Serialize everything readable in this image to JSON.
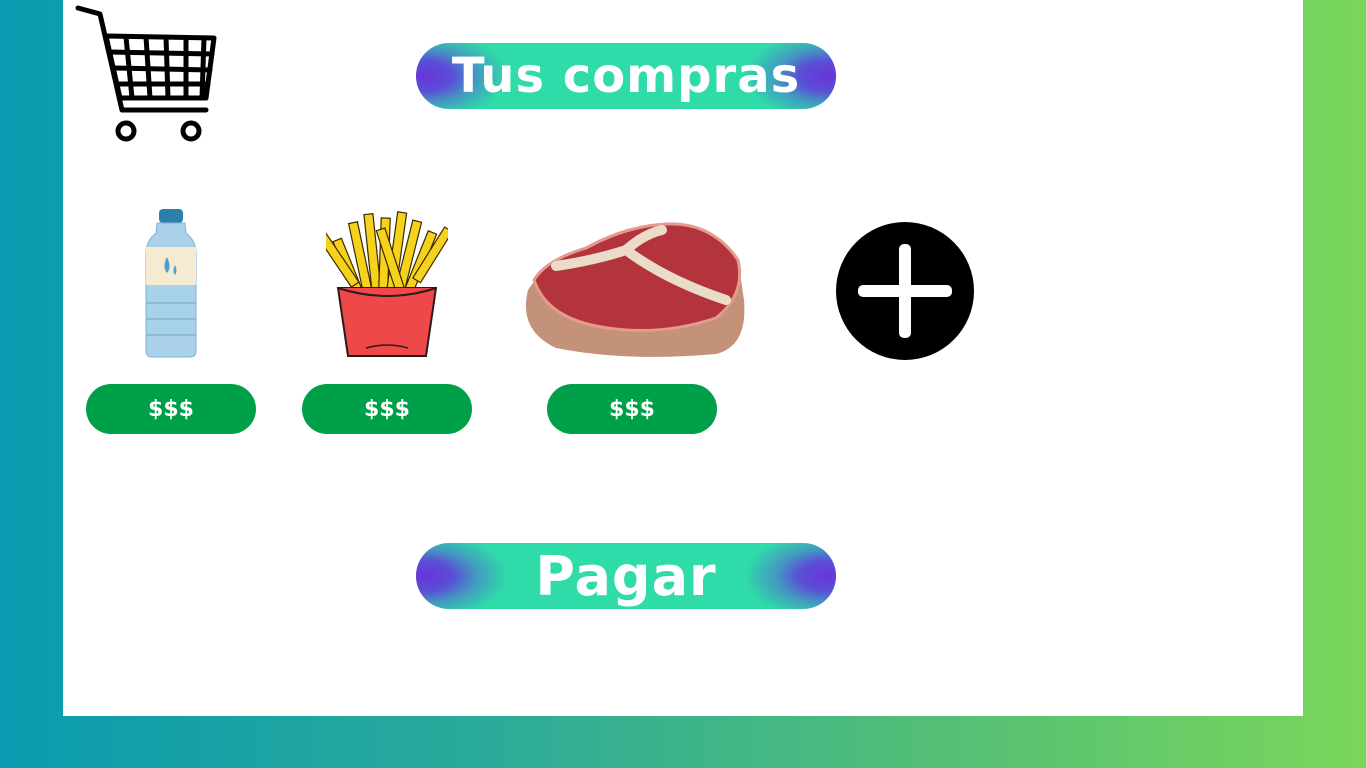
{
  "header": {
    "title": "Tus compras"
  },
  "cart": {
    "icon": "shopping-cart-icon"
  },
  "products": [
    {
      "name": "water-bottle",
      "icon": "water-bottle-icon",
      "price_label": "$$$"
    },
    {
      "name": "french-fries",
      "icon": "french-fries-icon",
      "price_label": "$$$"
    },
    {
      "name": "t-bone-steak",
      "icon": "steak-icon",
      "price_label": "$$$"
    }
  ],
  "add": {
    "icon": "plus-circle-icon"
  },
  "footer": {
    "pay_label": "Pagar"
  },
  "colors": {
    "background_left": "#0a9bb0",
    "background_right": "#7ad65a",
    "pill": "#2fdba8",
    "pill_accent": "#6a34d8",
    "price_button": "#00a04a"
  }
}
